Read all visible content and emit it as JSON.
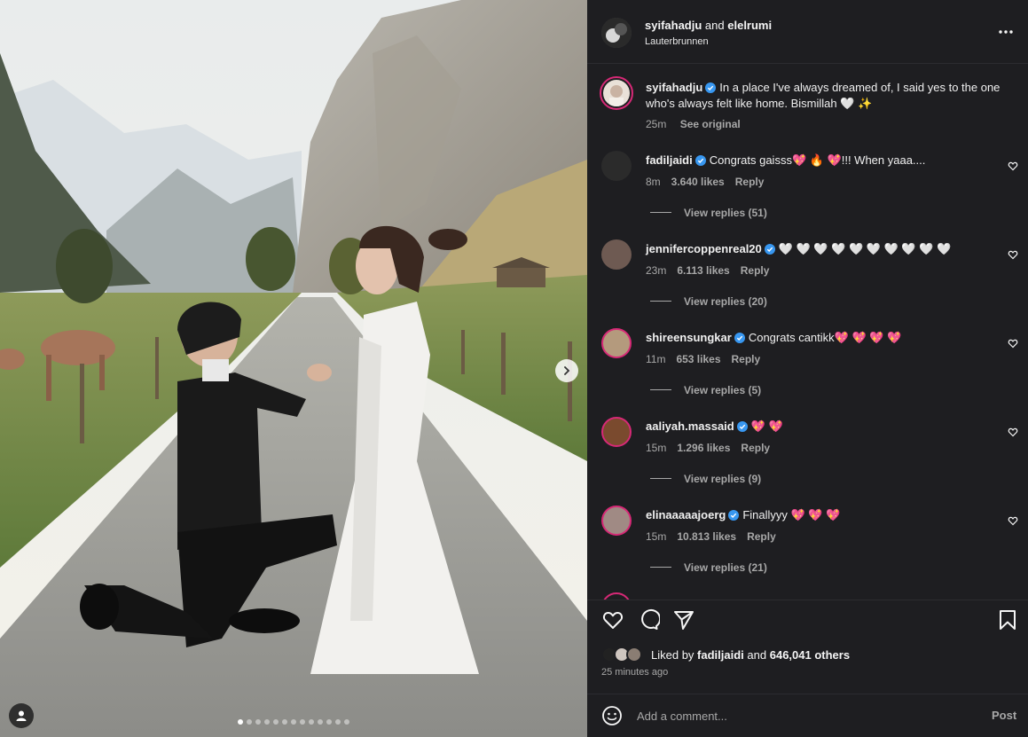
{
  "post": {
    "authors": {
      "first": "syifahadju",
      "conj": "and",
      "second": "elelrumi"
    },
    "location": "Lauterbrunnen",
    "carousel_dots": 13,
    "carousel_active": 0
  },
  "caption": {
    "user": "syifahadju",
    "text": "In a place I've always dreamed of, I said yes to the one who's always felt like home. Bismillah 🤍 ✨",
    "time": "25m",
    "see_original": "See original"
  },
  "comments": [
    {
      "user": "fadiljaidi",
      "text": "Congrats gaisss💖 🔥 💖!!! When yaaa....",
      "time": "8m",
      "likes": "3.640 likes",
      "reply": "Reply",
      "replies": "View replies (51)"
    },
    {
      "user": "jennifercoppenreal20",
      "text": "🤍 🤍 🤍 🤍 🤍 🤍 🤍 🤍 🤍 🤍",
      "time": "23m",
      "likes": "6.113 likes",
      "reply": "Reply",
      "replies": "View replies (20)"
    },
    {
      "user": "shireensungkar",
      "text": "Congrats cantikk💖 💖 💖 💖",
      "time": "11m",
      "likes": "653 likes",
      "reply": "Reply",
      "replies": "View replies (5)"
    },
    {
      "user": "aaliyah.massaid",
      "text": "💖 💖",
      "time": "15m",
      "likes": "1.296 likes",
      "reply": "Reply",
      "replies": "View replies (9)"
    },
    {
      "user": "elinaaaaajoerg",
      "text": "Finallyyy 💖 💖 💖",
      "time": "15m",
      "likes": "10.813 likes",
      "reply": "Reply",
      "replies": "View replies (21)"
    }
  ],
  "likes": {
    "prefix": "Liked by",
    "user": "fadiljaidi",
    "and": "and",
    "others": "646,041 others"
  },
  "posted_ago": "25 minutes ago",
  "add_comment": {
    "placeholder": "Add a comment...",
    "post_label": "Post"
  },
  "colors": {
    "panel_bg": "#1e1e21",
    "story_ring": "#d62976",
    "verified": "#3897f0",
    "muted": "#a8a8a8"
  }
}
